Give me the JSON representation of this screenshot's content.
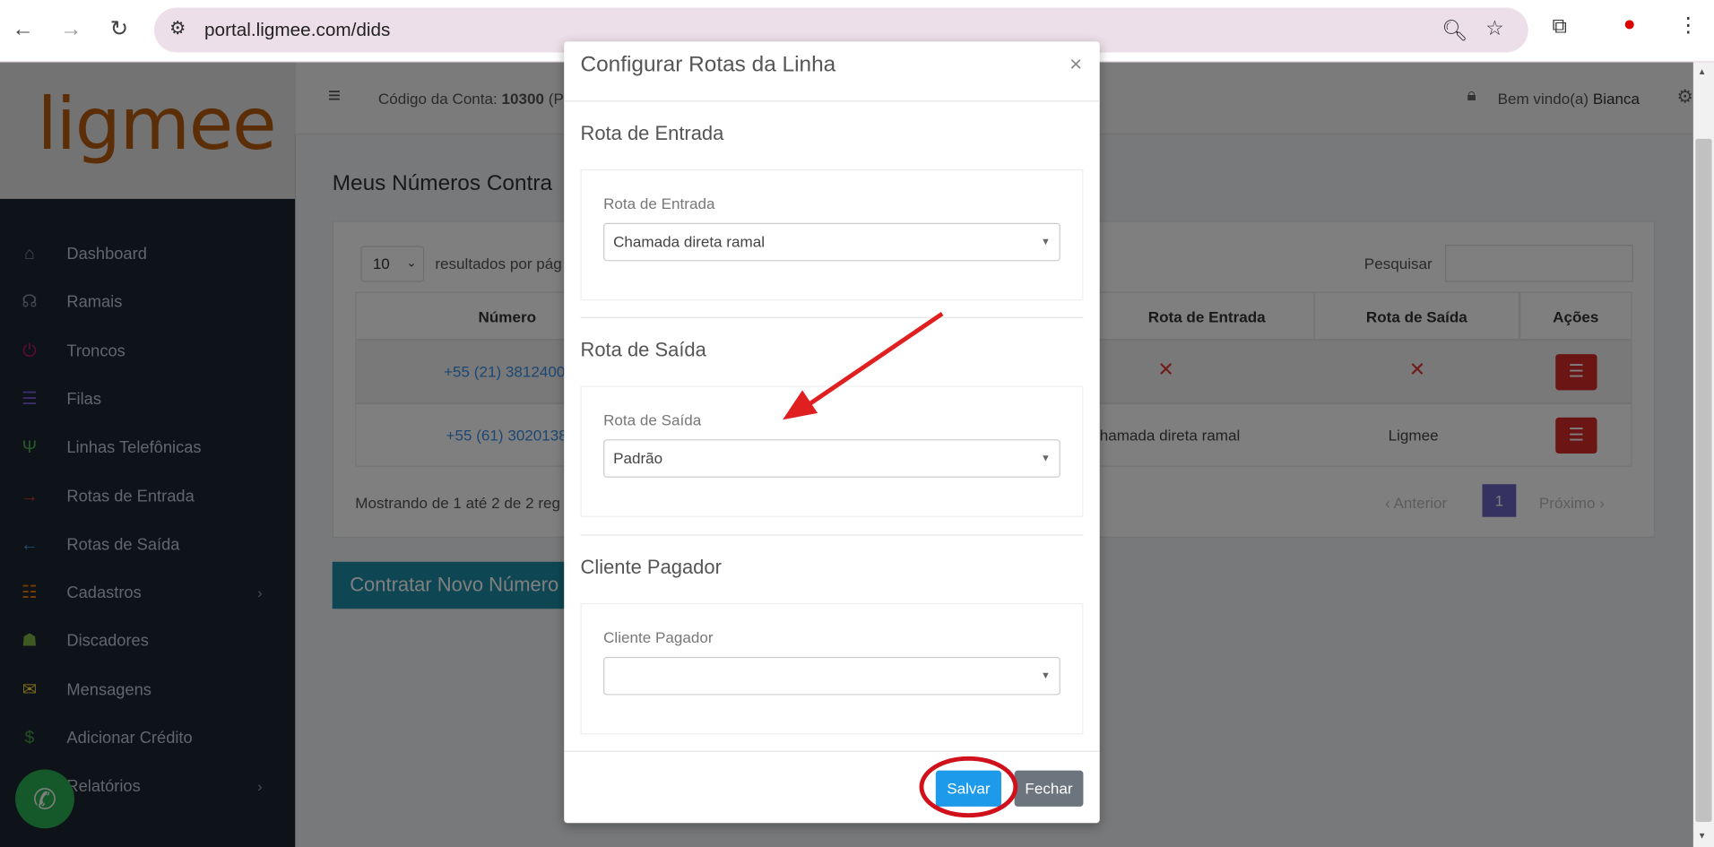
{
  "browser": {
    "url": "portal.ligmee.com/dids"
  },
  "sidebar": {
    "logo": "ligmee",
    "items": [
      {
        "label": "Dashboard",
        "icon": "home-icon",
        "color": "#8b949e"
      },
      {
        "label": "Ramais",
        "icon": "headset-icon",
        "color": "#8b949e"
      },
      {
        "label": "Troncos",
        "icon": "plug-icon",
        "color": "#c2185b"
      },
      {
        "label": "Filas",
        "icon": "list-icon",
        "color": "#7b5cd6"
      },
      {
        "label": "Linhas Telefônicas",
        "icon": "antenna-icon",
        "color": "#4caf50"
      },
      {
        "label": "Rotas de Entrada",
        "icon": "arrow-right-icon",
        "color": "#e53935"
      },
      {
        "label": "Rotas de Saída",
        "icon": "arrow-left-icon",
        "color": "#42a5f5"
      },
      {
        "label": "Cadastros",
        "icon": "cadastros-icon",
        "color": "#f57c00",
        "submenu": true
      },
      {
        "label": "Discadores",
        "icon": "android-icon",
        "color": "#7cb342"
      },
      {
        "label": "Mensagens",
        "icon": "envelope-icon",
        "color": "#fdd835"
      },
      {
        "label": "Adicionar Crédito",
        "icon": "dollar-icon",
        "color": "#43a047"
      },
      {
        "label": "Relatórios",
        "icon": "report-icon",
        "color": "#8b949e",
        "submenu": true
      }
    ]
  },
  "header": {
    "account_label": "Código da Conta:",
    "account_number": "10300",
    "account_suffix": "(P",
    "welcome": "Bem vindo(a)",
    "user": "Bianca"
  },
  "page": {
    "title": "Meus Números Contra",
    "per_page": "10",
    "per_page_label": "resultados por pág",
    "search_label": "Pesquisar",
    "columns": [
      "Número",
      "Rota de Entrada",
      "Rota de Saída",
      "Ações"
    ],
    "rows": [
      {
        "numero": "+55 (21) 3812400",
        "rota_entrada": "✕",
        "rota_saida": "✕"
      },
      {
        "numero": "+55 (61) 3020138",
        "rota_entrada": "hamada direta ramal",
        "rota_saida": "Ligmee"
      }
    ],
    "showing": "Mostrando de 1 até 2 de 2 reg",
    "prev": "‹ Anterior",
    "page": "1",
    "next": "Próximo ›",
    "new_button": "Contratar Novo Número"
  },
  "modal": {
    "title": "Configurar Rotas da Linha",
    "close": "×",
    "sections": [
      {
        "title": "Rota de Entrada",
        "label": "Rota de Entrada",
        "value": "Chamada direta ramal"
      },
      {
        "title": "Rota de Saída",
        "label": "Rota de Saída",
        "value": "Padrão"
      },
      {
        "title": "Cliente Pagador",
        "label": "Cliente Pagador",
        "value": ""
      }
    ],
    "save": "Salvar",
    "cancel": "Fechar"
  },
  "colors": {
    "accent": "#1e9aea",
    "annotation": "#e02020",
    "brand": "#b85c0e"
  }
}
